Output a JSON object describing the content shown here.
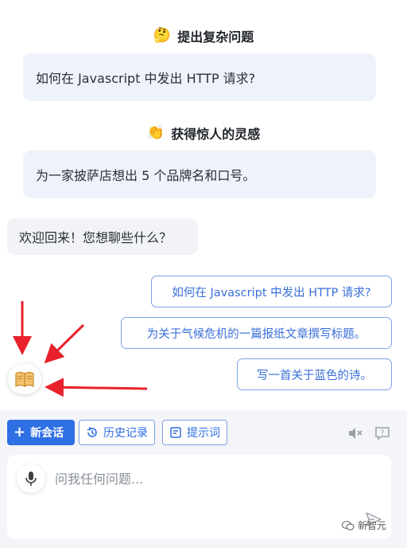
{
  "sections": [
    {
      "emoji": "🤔",
      "icon": "thinking-face-icon",
      "title": "提出复杂问题",
      "prompt": "如何在 Javascript 中发出 HTTP 请求?"
    },
    {
      "emoji": "👏",
      "icon": "clapping-hands-icon",
      "title": "获得惊人的灵感",
      "prompt": "为一家披萨店想出 5 个品牌名和口号。"
    }
  ],
  "welcome": "欢迎回来！您想聊些什么？",
  "suggestions": [
    "如何在 Javascript 中发出 HTTP 请求?",
    "为关于气候危机的一篇报纸文章撰写标题。",
    "写一首关于蓝色的诗。"
  ],
  "toolbar": {
    "new_chat": "新会话",
    "history": "历史记录",
    "prompts": "提示词"
  },
  "input": {
    "placeholder": "问我任何问题..."
  },
  "watermark": "新智元",
  "colors": {
    "primary": "#2f6fe4",
    "card": "#eef3fb",
    "annotation": "#e8212b"
  }
}
